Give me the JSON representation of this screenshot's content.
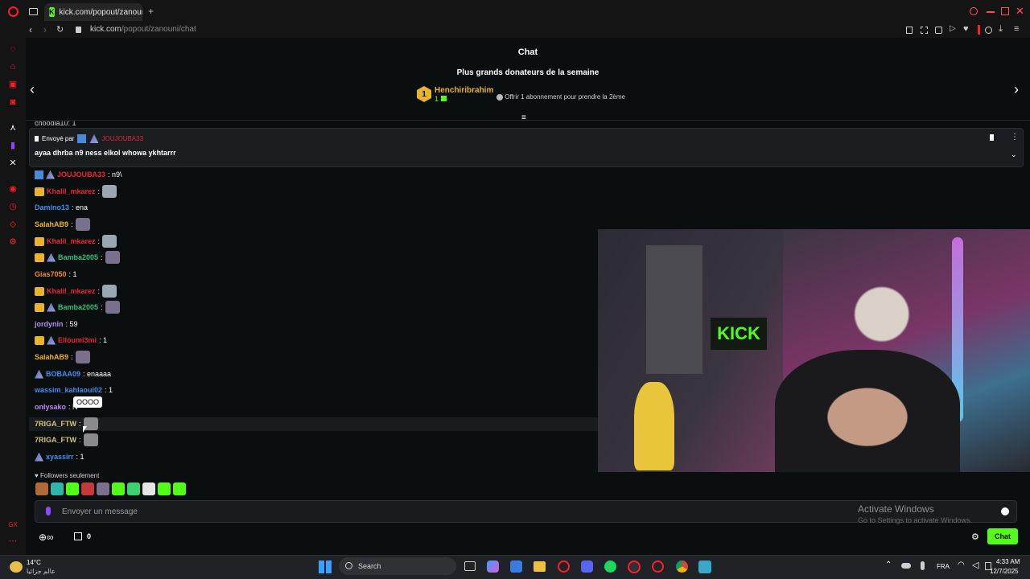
{
  "browser": {
    "tab_title": "kick.com/popout/zanouni",
    "url_host": "kick.com",
    "url_path": "/popout/zanouni/chat"
  },
  "header": {
    "title": "Chat",
    "donors_title": "Plus grands donateurs de la semaine",
    "top_donor": {
      "rank": "1",
      "name": "Henchiribrahim",
      "count": "1"
    },
    "offer_text": "Offrir 1 abonnement pour prendre la 2ème"
  },
  "truncated_top": "choodia10: 1",
  "pinned": {
    "sent_by_label": "Envoyé par",
    "author": "JOUJOUBA33",
    "text": "ayaa dhrba n9 ness elkol whowa ykhtarrr"
  },
  "messages": [
    {
      "user": "JOUJOUBA33",
      "text": ": n9\\",
      "color": "#e8223a"
    },
    {
      "user": "Khalil_mkarez",
      "text": ":",
      "color": "#e8223a"
    },
    {
      "user": "Damino13",
      "text": ": ena",
      "color": "#3e8ff0"
    },
    {
      "user": "SalahAB9",
      "text": ":",
      "color": "#e9b42a"
    },
    {
      "user": "Khalil_mkarez",
      "text": ":",
      "color": "#e8223a"
    },
    {
      "user": "Bamba2005",
      "text": ":",
      "color": "#2ec27e"
    },
    {
      "user": "Gias7050",
      "text": ": 1",
      "color": "#f08a24"
    },
    {
      "user": "Khalil_mkarez",
      "text": ":",
      "color": "#e8223a"
    },
    {
      "user": "Bamba2005",
      "text": ":",
      "color": "#2ec27e"
    },
    {
      "user": "jordynin",
      "text": ": 59",
      "color": "#b48cf0"
    },
    {
      "user": "Elloumi3mi",
      "text": ": 1",
      "color": "#e8223a"
    },
    {
      "user": "SalahAB9",
      "text": ":",
      "color": "#e9b42a"
    },
    {
      "user": "BOBAA09",
      "text": ": enaaaa",
      "color": "#3e8ff0"
    },
    {
      "user": "wassim_kahlaoui02",
      "text": ": 1",
      "color": "#3e8ff0"
    },
    {
      "user": "onlysako",
      "text": ": N",
      "color": "#b48cf0"
    },
    {
      "user": "7RIGA_FTW",
      "text": ":",
      "color": "#d6c27a"
    },
    {
      "user": "7RIGA_FTW",
      "text": ":",
      "color": "#d6c27a"
    },
    {
      "user": "xyassirr",
      "text": ": 1",
      "color": "#3e8ff0"
    }
  ],
  "tooltip": "OOOO",
  "followers_only": "Followers seulement",
  "input": {
    "placeholder": "Envoyer un message"
  },
  "watermark": {
    "title": "Activate Windows",
    "subtitle": "Go to Settings to activate Windows."
  },
  "bottom": {
    "points": "0",
    "chat_button": "Chat"
  },
  "taskbar": {
    "weather_temp": "14°C",
    "weather_desc": "عالم جزائيا",
    "search_label": "Search",
    "language": "FRA",
    "time": "4:33 AM",
    "date": "12/7/2025"
  },
  "video": {
    "sign_text": "KICK"
  },
  "colors": {
    "accent": "#53fc18",
    "gold": "#e9b42a"
  }
}
